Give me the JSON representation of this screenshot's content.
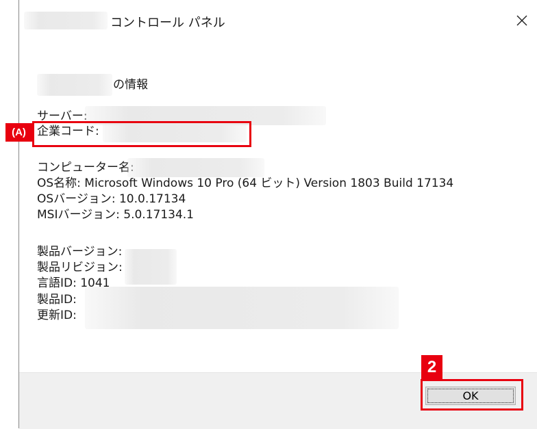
{
  "window": {
    "title": "コントロール パネル",
    "close_glyph": "×"
  },
  "info": {
    "heading": "の情報",
    "server_label": "サーバー:",
    "company_code_label": "企業コード:",
    "computer_name_label": "コンピューター名:",
    "os_name": "OS名称: Microsoft Windows 10 Pro (64 ビット) Version 1803 Build 17134",
    "os_version": "OSバージョン: 10.0.17134",
    "msi_version": "MSIバージョン: 5.0.17134.1",
    "product_version_label": "製品バージョン:",
    "product_revision_label": "製品リビジョン:",
    "language_id": "言語ID: 1041",
    "product_id_label": "製品ID:",
    "update_id_label": "更新ID:"
  },
  "buttons": {
    "ok_label": "OK"
  },
  "annotations": {
    "label_a": "(A)",
    "label_2": "2",
    "accent_color": "#e8000f"
  }
}
